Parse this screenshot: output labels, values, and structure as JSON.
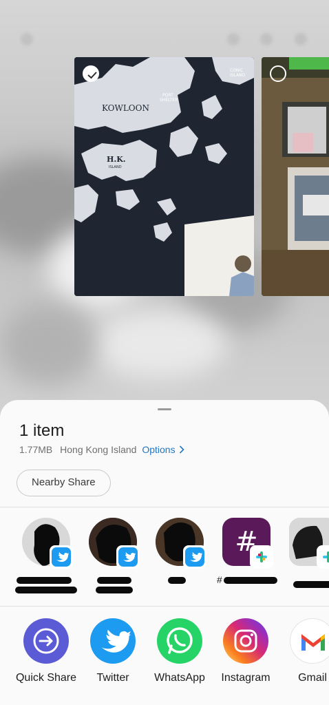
{
  "thumbnails": [
    {
      "name": "Hong Kong map photo",
      "selected": true
    },
    {
      "name": "street photo",
      "selected": false
    }
  ],
  "map_labels": {
    "kowloon": "KOWLOON",
    "hk": "H.K.",
    "island": "ISLAND",
    "port": "PORT",
    "shelter": "SHELTER",
    "conic": "CONIC",
    "conic_island": "ISLAND"
  },
  "share": {
    "title": "1 item",
    "size": "1.77MB",
    "location": "Hong Kong Island",
    "options_label": "Options",
    "options_icon": "chevron-right-icon",
    "nearby_label": "Nearby Share"
  },
  "contacts": [
    {
      "app": "twitter"
    },
    {
      "app": "twitter"
    },
    {
      "app": "twitter"
    },
    {
      "app": "slack",
      "label_prefix": "#"
    },
    {
      "app": "slack"
    }
  ],
  "apps": [
    {
      "label": "Quick Share",
      "icon": "quick-share-icon",
      "color": "#5b5bd6"
    },
    {
      "label": "Twitter",
      "icon": "twitter-icon",
      "color": "#1d9bf0"
    },
    {
      "label": "WhatsApp",
      "icon": "whatsapp-icon",
      "color": "#25d366"
    },
    {
      "label": "Instagram",
      "icon": "instagram-icon",
      "color": "#e1306c"
    },
    {
      "label": "Gmail",
      "icon": "gmail-icon",
      "color": "#ea4335"
    }
  ]
}
